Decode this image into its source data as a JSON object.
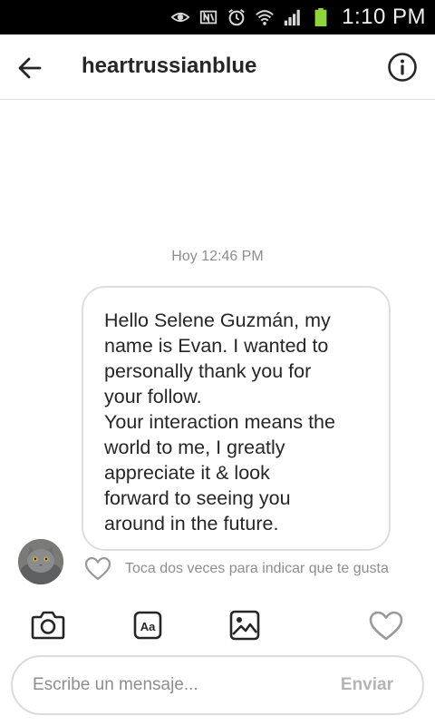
{
  "status_bar": {
    "time": "1:10 PM",
    "icons": [
      "eye-icon",
      "nfc-icon",
      "alarm-icon",
      "wifi-icon",
      "signal-icon",
      "battery-icon"
    ]
  },
  "header": {
    "title": "heartrussianblue",
    "back_icon": "arrow-left-icon",
    "info_icon": "info-circle-icon"
  },
  "conversation": {
    "timestamp": "Hoy 12:46 PM",
    "messages": [
      {
        "text": "Hello Selene Guzmán, my\nname is Evan. I wanted to\npersonally thank you for\nyour follow.\nYour interaction means the\nworld to me, I greatly\nappreciate it & look\nforward to seeing you\naround in the future."
      }
    ],
    "like_hint": "Toca dos veces para indicar que te gusta"
  },
  "toolbar": {
    "icons": [
      "camera-icon",
      "text-format-icon",
      "image-gallery-icon",
      "heart-icon"
    ]
  },
  "composer": {
    "placeholder": "Escribe un mensaje...",
    "send_label": "Enviar"
  },
  "colors": {
    "text_primary": "#262626",
    "text_secondary": "#8e8e8e",
    "border": "#dbdbdb",
    "send_disabled": "#b4b4b4",
    "battery": "#8fd43a"
  }
}
